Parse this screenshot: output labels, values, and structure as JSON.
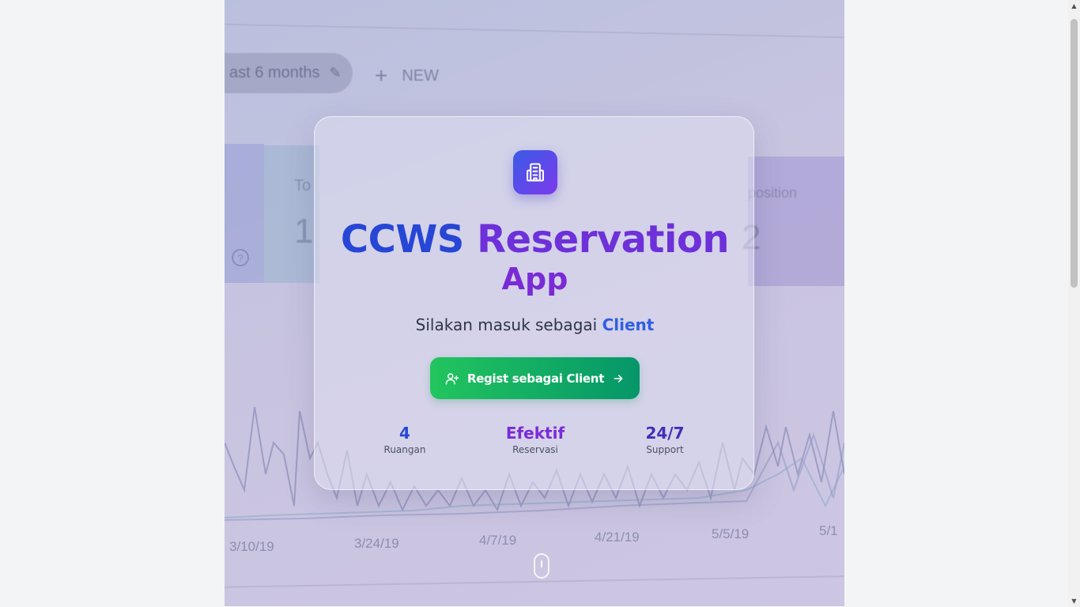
{
  "background": {
    "chip_text": "ast 6 months",
    "new_label": "NEW",
    "card_label_left": "To",
    "card_value_left": "1",
    "card_label_right": "position",
    "card_value_right": "2",
    "x_labels": [
      "3/10/19",
      "3/24/19",
      "4/7/19",
      "4/21/19",
      "5/5/19",
      "5/1"
    ]
  },
  "card": {
    "title_part1": "CCWS",
    "title_part2": "Reservation",
    "title_line2": "App",
    "subtitle_prefix": "Silakan masuk sebagai",
    "subtitle_role": "Client",
    "button_label": "Regist sebagai Client",
    "stats": [
      {
        "value": "4",
        "label": "Ruangan",
        "color": "#2746d6"
      },
      {
        "value": "Efektif",
        "label": "Reservasi",
        "color": "#7a2bd6"
      },
      {
        "value": "24/7",
        "label": "Support",
        "color": "#3f2fb8"
      }
    ]
  },
  "colors": {
    "brand_blue": "#2746d6",
    "brand_purple": "#6d30d9",
    "button_green_start": "#22c55e",
    "button_green_end": "#059669"
  },
  "icons": {
    "logo": "building-icon",
    "button_leading": "user-plus-icon",
    "button_trailing": "arrow-right-icon",
    "scroll_hint": "mouse-scroll-icon"
  }
}
